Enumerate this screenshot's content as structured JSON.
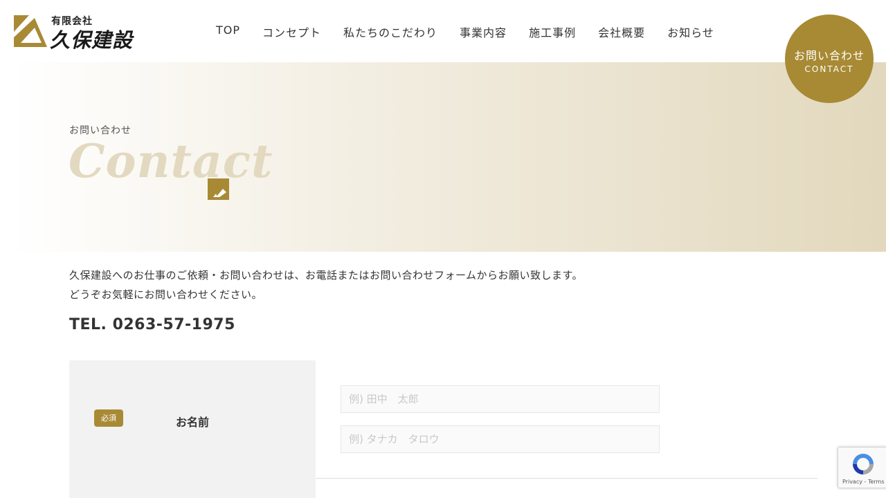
{
  "header": {
    "logo_small": "有限会社",
    "logo_big": "久保建設",
    "nav": [
      "TOP",
      "コンセプト",
      "私たちのこだわり",
      "事業内容",
      "施工事例",
      "会社概要",
      "お知らせ"
    ],
    "contact_jp": "お問い合わせ",
    "contact_en": "CONTACT"
  },
  "hero": {
    "subtitle": "お問い合わせ",
    "title": "Contact"
  },
  "intro": {
    "line1": "久保建設へのお仕事のご依頼・お問い合わせは、お電話またはお問い合わせフォームからお願い致します。",
    "line2": "どうぞお気軽にお問い合わせください。"
  },
  "tel": "TEL. 0263-57-1975",
  "form": {
    "required_badge": "必須",
    "name_label": "お名前",
    "name_placeholder": "例) 田中　太郎",
    "kana_placeholder": "例) タナカ　タロウ"
  },
  "recaptcha": {
    "text": "Privacy - Terms"
  },
  "colors": {
    "accent": "#a88a35",
    "hero_title": "#e2d9c0"
  },
  "icons": [
    "logo-mark-icon",
    "pencil-note-icon",
    "recaptcha-icon"
  ]
}
